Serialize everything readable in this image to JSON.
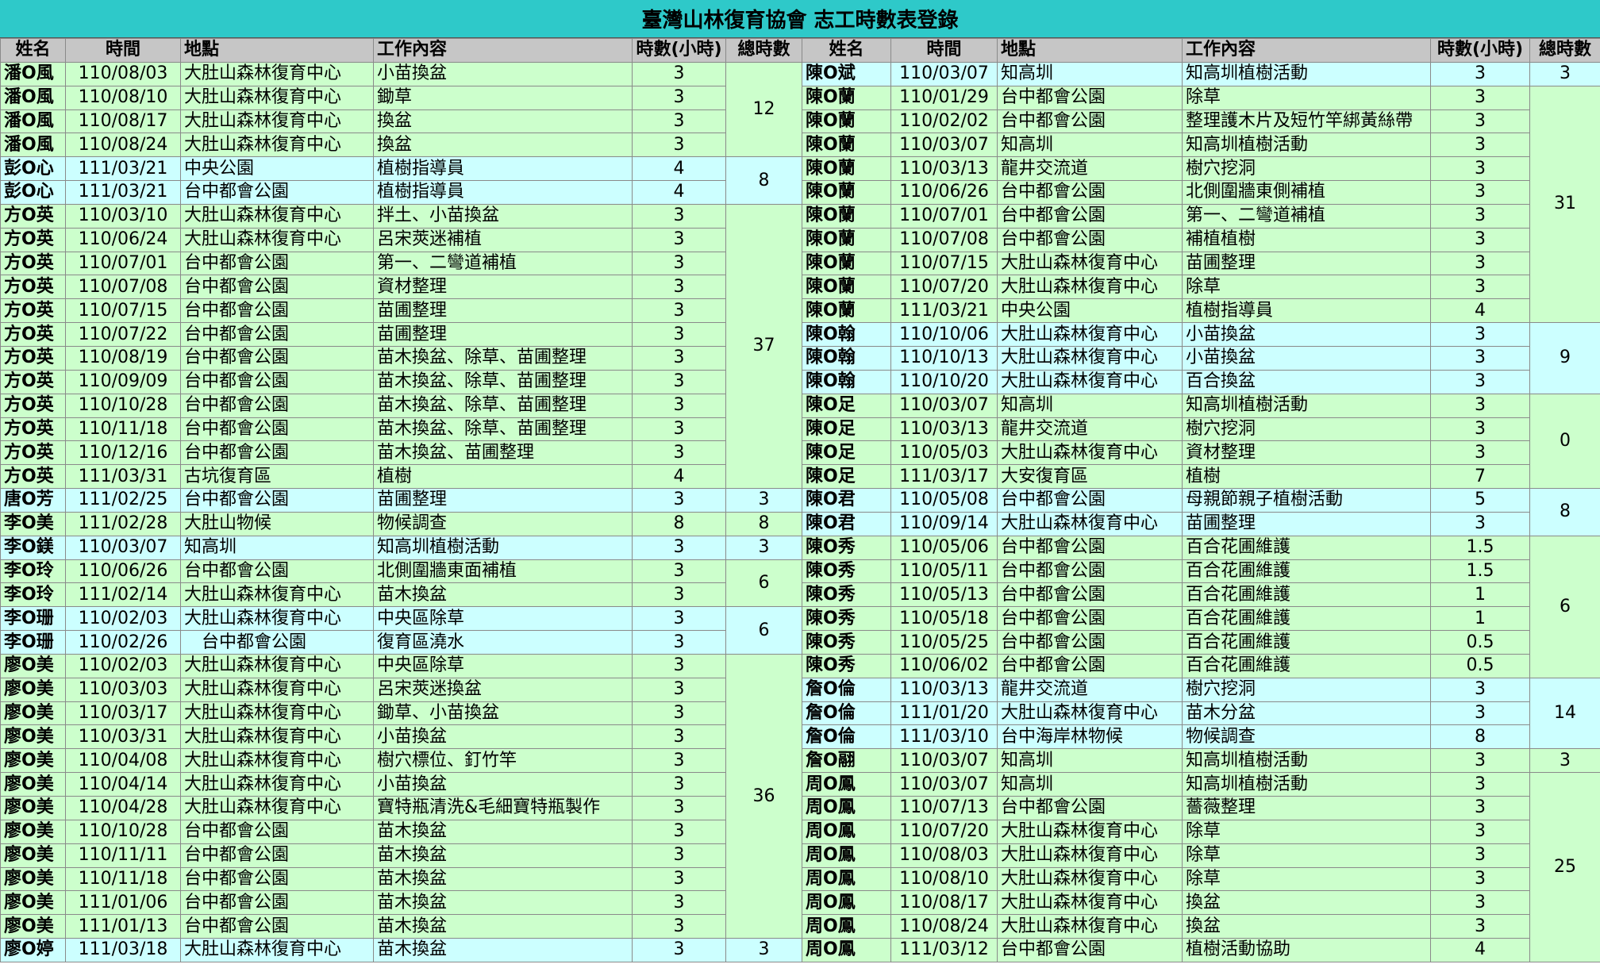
{
  "title": "臺灣山林復育協會 志工時數表登錄",
  "headers": [
    "姓名",
    "時間",
    "地點",
    "工作內容",
    "時數(小時)",
    "總時數"
  ],
  "left_rows": [
    {
      "name": "潘O風",
      "date": "110/08/03",
      "place": "大肚山森林復育中心",
      "work": "小苗換盆",
      "hours": "3"
    },
    {
      "name": "潘O風",
      "date": "110/08/10",
      "place": "大肚山森林復育中心",
      "work": "鋤草",
      "hours": "3"
    },
    {
      "name": "潘O風",
      "date": "110/08/17",
      "place": "大肚山森林復育中心",
      "work": "換盆",
      "hours": "3"
    },
    {
      "name": "潘O風",
      "date": "110/08/24",
      "place": "大肚山森林復育中心",
      "work": "換盆",
      "hours": "3"
    },
    {
      "name": "彭O心",
      "date": "111/03/21",
      "place": "中央公園",
      "work": "植樹指導員",
      "hours": "4"
    },
    {
      "name": "彭O心",
      "date": "111/03/21",
      "place": "台中都會公園",
      "work": "植樹指導員",
      "hours": "4"
    },
    {
      "name": "方O英",
      "date": "110/03/10",
      "place": "大肚山森林復育中心",
      "work": "拌土、小苗換盆",
      "hours": "3"
    },
    {
      "name": "方O英",
      "date": "110/06/24",
      "place": "大肚山森林復育中心",
      "work": "呂宋莢迷補植",
      "hours": "3"
    },
    {
      "name": "方O英",
      "date": "110/07/01",
      "place": "台中都會公園",
      "work": "第一、二彎道補植",
      "hours": "3"
    },
    {
      "name": "方O英",
      "date": "110/07/08",
      "place": "台中都會公園",
      "work": "資材整理",
      "hours": "3"
    },
    {
      "name": "方O英",
      "date": "110/07/15",
      "place": "台中都會公園",
      "work": "苗圃整理",
      "hours": "3"
    },
    {
      "name": "方O英",
      "date": "110/07/22",
      "place": "台中都會公園",
      "work": "苗圃整理",
      "hours": "3"
    },
    {
      "name": "方O英",
      "date": "110/08/19",
      "place": "台中都會公園",
      "work": "苗木換盆、除草、苗圃整理",
      "hours": "3"
    },
    {
      "name": "方O英",
      "date": "110/09/09",
      "place": "台中都會公園",
      "work": "苗木換盆、除草、苗圃整理",
      "hours": "3"
    },
    {
      "name": "方O英",
      "date": "110/10/28",
      "place": "台中都會公園",
      "work": "苗木換盆、除草、苗圃整理",
      "hours": "3"
    },
    {
      "name": "方O英",
      "date": "110/11/18",
      "place": "台中都會公園",
      "work": "苗木換盆、除草、苗圃整理",
      "hours": "3"
    },
    {
      "name": "方O英",
      "date": "110/12/16",
      "place": "台中都會公園",
      "work": "苗木換盆、苗圃整理",
      "hours": "3"
    },
    {
      "name": "方O英",
      "date": "111/03/31",
      "place": "古坑復育區",
      "work": "植樹",
      "hours": "4"
    },
    {
      "name": "唐O芳",
      "date": "111/02/25",
      "place": "台中都會公園",
      "work": "苗圃整理",
      "hours": "3"
    },
    {
      "name": "李O美",
      "date": "111/02/28",
      "place": "大肚山物候",
      "work": "物候調查",
      "hours": "8"
    },
    {
      "name": "李O鎂",
      "date": "110/03/07",
      "place": "知高圳",
      "work": "知高圳植樹活動",
      "hours": "3"
    },
    {
      "name": "李O玲",
      "date": "110/06/26",
      "place": "台中都會公園",
      "work": "北側圍牆東面補植",
      "hours": "3"
    },
    {
      "name": "李O玲",
      "date": "111/02/14",
      "place": "大肚山森林復育中心",
      "work": "苗木換盆",
      "hours": "3"
    },
    {
      "name": "李O珊",
      "date": "110/02/03",
      "place": "大肚山森林復育中心",
      "work": "中央區除草",
      "hours": "3"
    },
    {
      "name": "李O珊",
      "date": "110/02/26",
      "place": "　台中都會公園",
      "work": "復育區澆水",
      "hours": "3"
    },
    {
      "name": "廖O美",
      "date": "110/02/03",
      "place": "大肚山森林復育中心",
      "work": "中央區除草",
      "hours": "3"
    },
    {
      "name": "廖O美",
      "date": "110/03/03",
      "place": "大肚山森林復育中心",
      "work": "呂宋莢迷換盆",
      "hours": "3"
    },
    {
      "name": "廖O美",
      "date": "110/03/17",
      "place": "大肚山森林復育中心",
      "work": "鋤草、小苗換盆",
      "hours": "3"
    },
    {
      "name": "廖O美",
      "date": "110/03/31",
      "place": "大肚山森林復育中心",
      "work": "小苗換盆",
      "hours": "3"
    },
    {
      "name": "廖O美",
      "date": "110/04/08",
      "place": "大肚山森林復育中心",
      "work": "樹穴標位、釘竹竿",
      "hours": "3"
    },
    {
      "name": "廖O美",
      "date": "110/04/14",
      "place": "大肚山森林復育中心",
      "work": "小苗換盆",
      "hours": "3"
    },
    {
      "name": "廖O美",
      "date": "110/04/28",
      "place": "大肚山森林復育中心",
      "work": "寶特瓶清洗&毛細寶特瓶製作",
      "hours": "3"
    },
    {
      "name": "廖O美",
      "date": "110/10/28",
      "place": "台中都會公園",
      "work": "苗木換盆",
      "hours": "3"
    },
    {
      "name": "廖O美",
      "date": "110/11/11",
      "place": "台中都會公園",
      "work": "苗木換盆",
      "hours": "3"
    },
    {
      "name": "廖O美",
      "date": "110/11/18",
      "place": "台中都會公園",
      "work": "苗木換盆",
      "hours": "3"
    },
    {
      "name": "廖O美",
      "date": "111/01/06",
      "place": "台中都會公園",
      "work": "苗木換盆",
      "hours": "3"
    },
    {
      "name": "廖O美",
      "date": "111/01/13",
      "place": "台中都會公園",
      "work": "苗木換盆",
      "hours": "3"
    },
    {
      "name": "廖O婷",
      "date": "111/03/18",
      "place": "大肚山森林復育中心",
      "work": "苗木換盆",
      "hours": "3"
    }
  ],
  "left_groups": [
    {
      "rows": 4,
      "total": "12",
      "color": "g"
    },
    {
      "rows": 2,
      "total": "8",
      "color": "c"
    },
    {
      "rows": 12,
      "total": "37",
      "color": "g"
    },
    {
      "rows": 1,
      "total": "3",
      "color": "c"
    },
    {
      "rows": 1,
      "total": "8",
      "color": "g"
    },
    {
      "rows": 1,
      "total": "3",
      "color": "c"
    },
    {
      "rows": 2,
      "total": "6",
      "color": "g"
    },
    {
      "rows": 2,
      "total": "6",
      "color": "c"
    },
    {
      "rows": 12,
      "total": "36",
      "color": "g"
    },
    {
      "rows": 1,
      "total": "3",
      "color": "c"
    }
  ],
  "right_rows": [
    {
      "name": "陳O斌",
      "date": "110/03/07",
      "place": "知高圳",
      "work": "知高圳植樹活動",
      "hours": "3"
    },
    {
      "name": "陳O蘭",
      "date": "110/01/29",
      "place": "台中都會公園",
      "work": "除草",
      "hours": "3"
    },
    {
      "name": "陳O蘭",
      "date": "110/02/02",
      "place": "台中都會公園",
      "work": "整理護木片及短竹竿綁黃絲帶",
      "hours": "3"
    },
    {
      "name": "陳O蘭",
      "date": "110/03/07",
      "place": "知高圳",
      "work": "知高圳植樹活動",
      "hours": "3"
    },
    {
      "name": "陳O蘭",
      "date": "110/03/13",
      "place": "龍井交流道",
      "work": "樹穴挖洞",
      "hours": "3"
    },
    {
      "name": "陳O蘭",
      "date": "110/06/26",
      "place": "台中都會公園",
      "work": "北側圍牆東側補植",
      "hours": "3"
    },
    {
      "name": "陳O蘭",
      "date": "110/07/01",
      "place": "台中都會公園",
      "work": "第一、二彎道補植",
      "hours": "3"
    },
    {
      "name": "陳O蘭",
      "date": "110/07/08",
      "place": "台中都會公園",
      "work": "補植植樹",
      "hours": "3"
    },
    {
      "name": "陳O蘭",
      "date": "110/07/15",
      "place": "大肚山森林復育中心",
      "work": "苗圃整理",
      "hours": "3"
    },
    {
      "name": "陳O蘭",
      "date": "110/07/20",
      "place": "大肚山森林復育中心",
      "work": "除草",
      "hours": "3"
    },
    {
      "name": "陳O蘭",
      "date": "111/03/21",
      "place": "中央公園",
      "work": "植樹指導員",
      "hours": "4"
    },
    {
      "name": "陳O翰",
      "date": "110/10/06",
      "place": "大肚山森林復育中心",
      "work": "小苗換盆",
      "hours": "3"
    },
    {
      "name": "陳O翰",
      "date": "110/10/13",
      "place": "大肚山森林復育中心",
      "work": "小苗換盆",
      "hours": "3"
    },
    {
      "name": "陳O翰",
      "date": "110/10/20",
      "place": "大肚山森林復育中心",
      "work": "百合換盆",
      "hours": "3"
    },
    {
      "name": "陳O足",
      "date": "110/03/07",
      "place": "知高圳",
      "work": "知高圳植樹活動",
      "hours": "3"
    },
    {
      "name": "陳O足",
      "date": "110/03/13",
      "place": "龍井交流道",
      "work": "樹穴挖洞",
      "hours": "3"
    },
    {
      "name": "陳O足",
      "date": "110/05/03",
      "place": "大肚山森林復育中心",
      "work": "資材整理",
      "hours": "3"
    },
    {
      "name": "陳O足",
      "date": "111/03/17",
      "place": "大安復育區",
      "work": "植樹",
      "hours": "7"
    },
    {
      "name": "陳O君",
      "date": "110/05/08",
      "place": "台中都會公園",
      "work": "母親節親子植樹活動",
      "hours": "5"
    },
    {
      "name": "陳O君",
      "date": "110/09/14",
      "place": "大肚山森林復育中心",
      "work": "苗圃整理",
      "hours": "3"
    },
    {
      "name": "陳O秀",
      "date": "110/05/06",
      "place": "台中都會公園",
      "work": "百合花圃維護",
      "hours": "1.5"
    },
    {
      "name": "陳O秀",
      "date": "110/05/11",
      "place": "台中都會公園",
      "work": "百合花圃維護",
      "hours": "1.5"
    },
    {
      "name": "陳O秀",
      "date": "110/05/13",
      "place": "台中都會公園",
      "work": "百合花圃維護",
      "hours": "1"
    },
    {
      "name": "陳O秀",
      "date": "110/05/18",
      "place": "台中都會公園",
      "work": "百合花圃維護",
      "hours": "1"
    },
    {
      "name": "陳O秀",
      "date": "110/05/25",
      "place": "台中都會公園",
      "work": "百合花圃維護",
      "hours": "0.5"
    },
    {
      "name": "陳O秀",
      "date": "110/06/02",
      "place": "台中都會公園",
      "work": "百合花圃維護",
      "hours": "0.5"
    },
    {
      "name": "詹O倫",
      "date": "110/03/13",
      "place": "龍井交流道",
      "work": "樹穴挖洞",
      "hours": "3"
    },
    {
      "name": "詹O倫",
      "date": "111/01/20",
      "place": "大肚山森林復育中心",
      "work": "苗木分盆",
      "hours": "3"
    },
    {
      "name": "詹O倫",
      "date": "111/03/10",
      "place": "台中海岸林物候",
      "work": "物候調查",
      "hours": "8"
    },
    {
      "name": "詹O翮",
      "date": "110/03/07",
      "place": "知高圳",
      "work": "知高圳植樹活動",
      "hours": "3"
    },
    {
      "name": "周O鳳",
      "date": "110/03/07",
      "place": "知高圳",
      "work": "知高圳植樹活動",
      "hours": "3"
    },
    {
      "name": "周O鳳",
      "date": "110/07/13",
      "place": "台中都會公園",
      "work": "薔薇整理",
      "hours": "3"
    },
    {
      "name": "周O鳳",
      "date": "110/07/20",
      "place": "大肚山森林復育中心",
      "work": "除草",
      "hours": "3"
    },
    {
      "name": "周O鳳",
      "date": "110/08/03",
      "place": "大肚山森林復育中心",
      "work": "除草",
      "hours": "3"
    },
    {
      "name": "周O鳳",
      "date": "110/08/10",
      "place": "大肚山森林復育中心",
      "work": "除草",
      "hours": "3"
    },
    {
      "name": "周O鳳",
      "date": "110/08/17",
      "place": "大肚山森林復育中心",
      "work": "換盆",
      "hours": "3"
    },
    {
      "name": "周O鳳",
      "date": "110/08/24",
      "place": "大肚山森林復育中心",
      "work": "換盆",
      "hours": "3"
    },
    {
      "name": "周O鳳",
      "date": "111/03/12",
      "place": "台中都會公園",
      "work": "植樹活動協助",
      "hours": "4"
    }
  ],
  "right_groups": [
    {
      "rows": 1,
      "total": "3",
      "color": "c"
    },
    {
      "rows": 10,
      "total": "31",
      "color": "g"
    },
    {
      "rows": 3,
      "total": "9",
      "color": "c"
    },
    {
      "rows": 4,
      "total": "0",
      "color": "g"
    },
    {
      "rows": 2,
      "total": "8",
      "color": "c"
    },
    {
      "rows": 6,
      "total": "6",
      "color": "g"
    },
    {
      "rows": 3,
      "total": "14",
      "color": "c"
    },
    {
      "rows": 1,
      "total": "3",
      "color": "g"
    },
    {
      "rows": 8,
      "total": "25",
      "color": "g"
    }
  ]
}
